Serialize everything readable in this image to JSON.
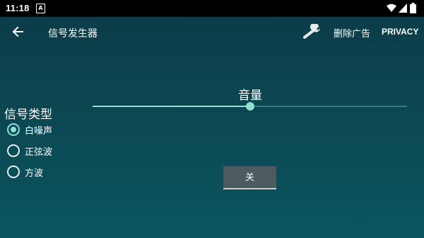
{
  "status_bar": {
    "time": "11:18",
    "notification_icon": "a-box-icon",
    "icons": [
      "wifi-icon",
      "signal-icon",
      "battery-icon"
    ]
  },
  "app_bar": {
    "title": "信号发生器",
    "back_icon": "arrow-left-icon",
    "tool_icon": "wrench-icon",
    "remove_ads_label": "删除广告",
    "privacy_label": "PRIVACY"
  },
  "volume": {
    "label": "音量",
    "value_fraction": 0.5
  },
  "signal_type": {
    "heading": "信号类型",
    "options": [
      {
        "label": "白噪声",
        "selected": true
      },
      {
        "label": "正弦波",
        "selected": false
      },
      {
        "label": "方波",
        "selected": false
      }
    ]
  },
  "toggle_button": {
    "label": "关"
  },
  "colors": {
    "accent": "#8fe0d0",
    "background_top": "#0c3b48",
    "background_bottom": "#0a5660",
    "button_bg": "#4b5b5f"
  }
}
